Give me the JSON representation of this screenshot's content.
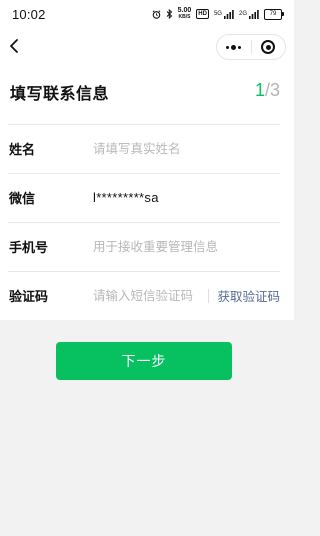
{
  "status_bar": {
    "time": "10:02",
    "net_speed_value": "5.00",
    "net_speed_unit": "KB/S",
    "hd_label": "HD",
    "signal_1_label": "5G",
    "signal_2_label": "2G",
    "battery": "79"
  },
  "nav": {
    "back_icon": "chevron-left-icon",
    "more_icon": "more-dots-icon",
    "close_icon": "target-circle-icon"
  },
  "form": {
    "title": "填写联系信息",
    "step_current": "1",
    "step_total": "/3",
    "fields": {
      "name": {
        "label": "姓名",
        "placeholder": "请填写真实姓名",
        "value": ""
      },
      "wechat": {
        "label": "微信",
        "value": "l*********sa"
      },
      "phone": {
        "label": "手机号",
        "placeholder": "用于接收重要管理信息",
        "value": ""
      },
      "code": {
        "label": "验证码",
        "placeholder": "请输入短信验证码",
        "value": "",
        "action": "获取验证码"
      }
    }
  },
  "next_button": {
    "label": "下一步"
  },
  "colors": {
    "accent": "#07c160",
    "link": "#576b95",
    "background": "#f2f2f2"
  }
}
